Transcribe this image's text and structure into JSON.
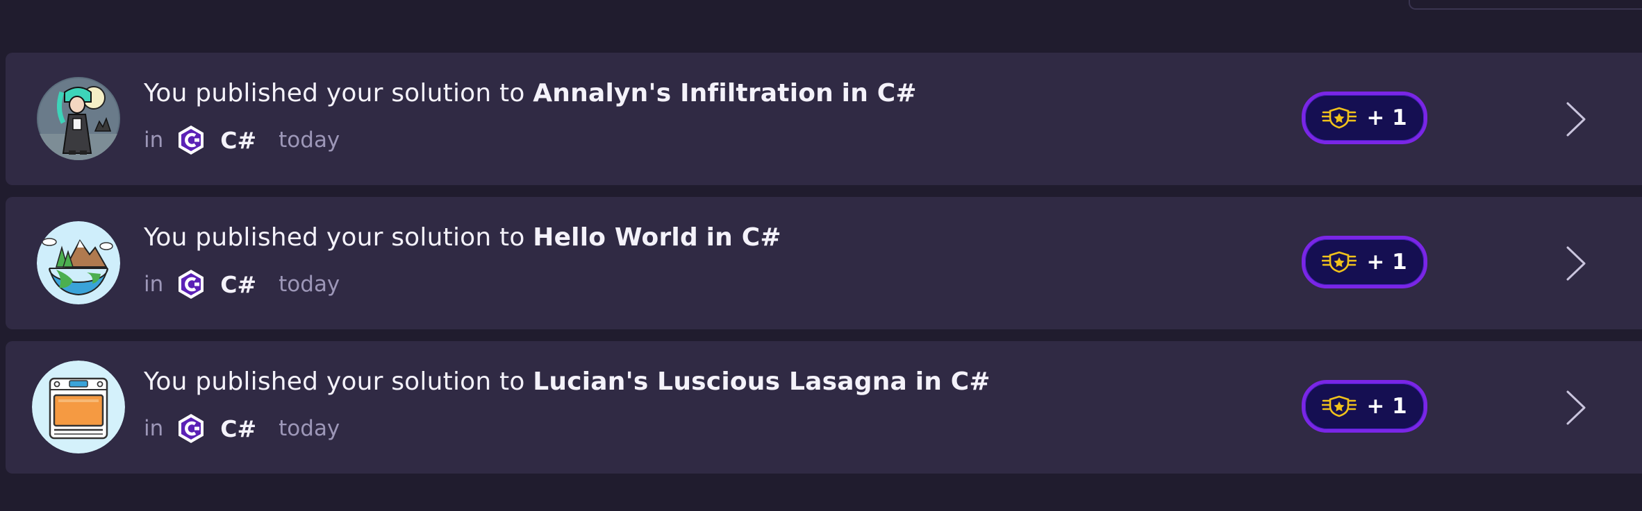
{
  "colors": {
    "page_background": "#201c2e",
    "card_background": "#302a44",
    "reputation_border": "#7a26e6",
    "reputation_fill": "#150f52",
    "reputation_icon": "#f1c21b",
    "muted_text": "#9d97b8"
  },
  "activities": [
    {
      "prefix": "You published your solution to",
      "exercise": "Annalyn's Infiltration",
      "suffix": "in C#",
      "in_label": "in",
      "track": "C#",
      "track_icon": "csharp-hexagon-icon",
      "time": "today",
      "reputation": "+ 1",
      "avatar_icon": "annalyn-character-icon"
    },
    {
      "prefix": "You published your solution to",
      "exercise": "Hello World",
      "suffix": "in C#",
      "in_label": "in",
      "track": "C#",
      "track_icon": "csharp-hexagon-icon",
      "time": "today",
      "reputation": "+ 1",
      "avatar_icon": "earth-landscape-icon"
    },
    {
      "prefix": "You published your solution to",
      "exercise": "Lucian's Luscious Lasagna",
      "suffix": "in C#",
      "in_label": "in",
      "track": "C#",
      "track_icon": "csharp-hexagon-icon",
      "time": "today",
      "reputation": "+ 1",
      "avatar_icon": "oven-icon"
    }
  ]
}
